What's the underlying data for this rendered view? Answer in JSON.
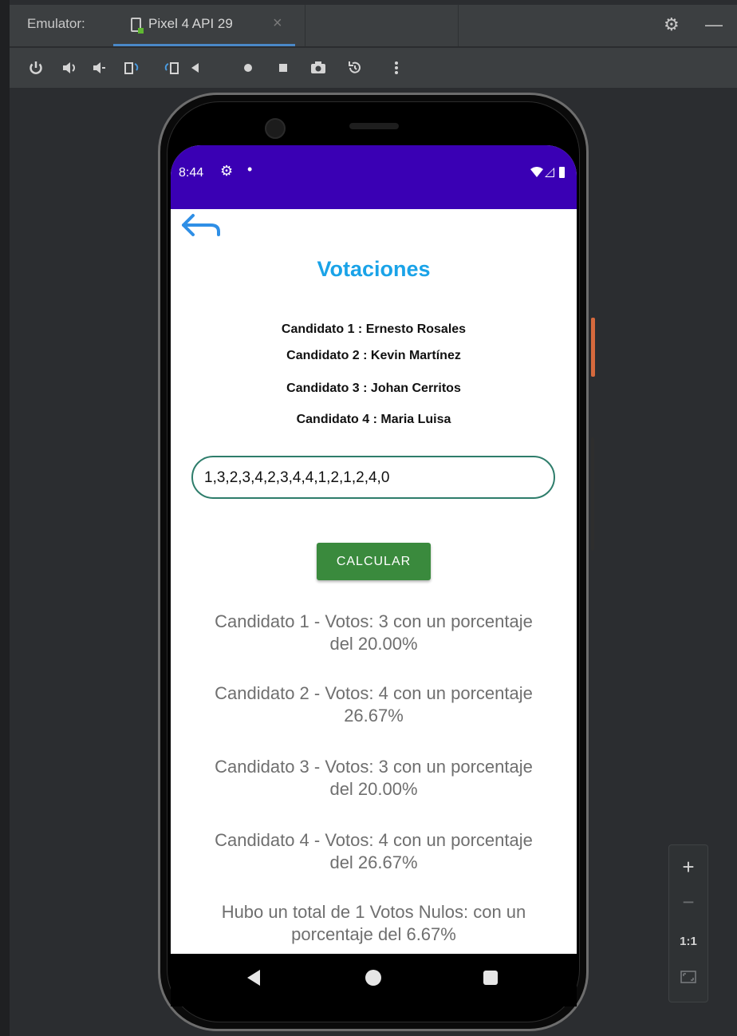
{
  "window": {
    "label": "Emulator:",
    "tab_title": "Pixel 4 API 29",
    "tab_close": "×"
  },
  "toolbar": {
    "tools": [
      "power-icon",
      "volume-up-icon",
      "volume-down-icon",
      "rotate-left-icon",
      "rotate-right-icon",
      "back-icon",
      "home-icon",
      "overview-icon",
      "screenshot-icon",
      "snapshot-icon",
      "more-icon"
    ]
  },
  "status_bar": {
    "time": "8:44"
  },
  "app": {
    "title": "Votaciones",
    "candidates": [
      "Candidato 1 : Ernesto Rosales",
      "Candidato 2 : Kevin Martínez",
      "Candidato 3 : Johan Cerritos",
      "Candidato 4 : Maria Luisa"
    ],
    "votes_input": "1,3,2,3,4,2,3,4,4,1,2,1,2,4,0",
    "calculate_button": "CALCULAR",
    "results": [
      {
        "line1": "Candidato 1 - Votos: 3 con un porcentaje",
        "line2": "del 20.00%"
      },
      {
        "line1": "Candidato 2 - Votos: 4 con un porcentaje",
        "line2": "26.67%"
      },
      {
        "line1": "Candidato 3 - Votos: 3 con un porcentaje",
        "line2": "del 20.00%"
      },
      {
        "line1": "Candidato 4 - Votos: 4 con un porcentaje",
        "line2": "del 26.67%"
      },
      {
        "line1": "Hubo un total de 1 Votos Nulos:  con un",
        "line2": "porcentaje del 6.67%"
      }
    ]
  },
  "zoom": {
    "zoom_in": "+",
    "zoom_out": "−",
    "actual_size": "1:1"
  },
  "colors": {
    "status_bar": "#3a00b4",
    "title": "#1aa3e8",
    "button": "#3a8a3d",
    "input_border": "#2e7d6b"
  }
}
